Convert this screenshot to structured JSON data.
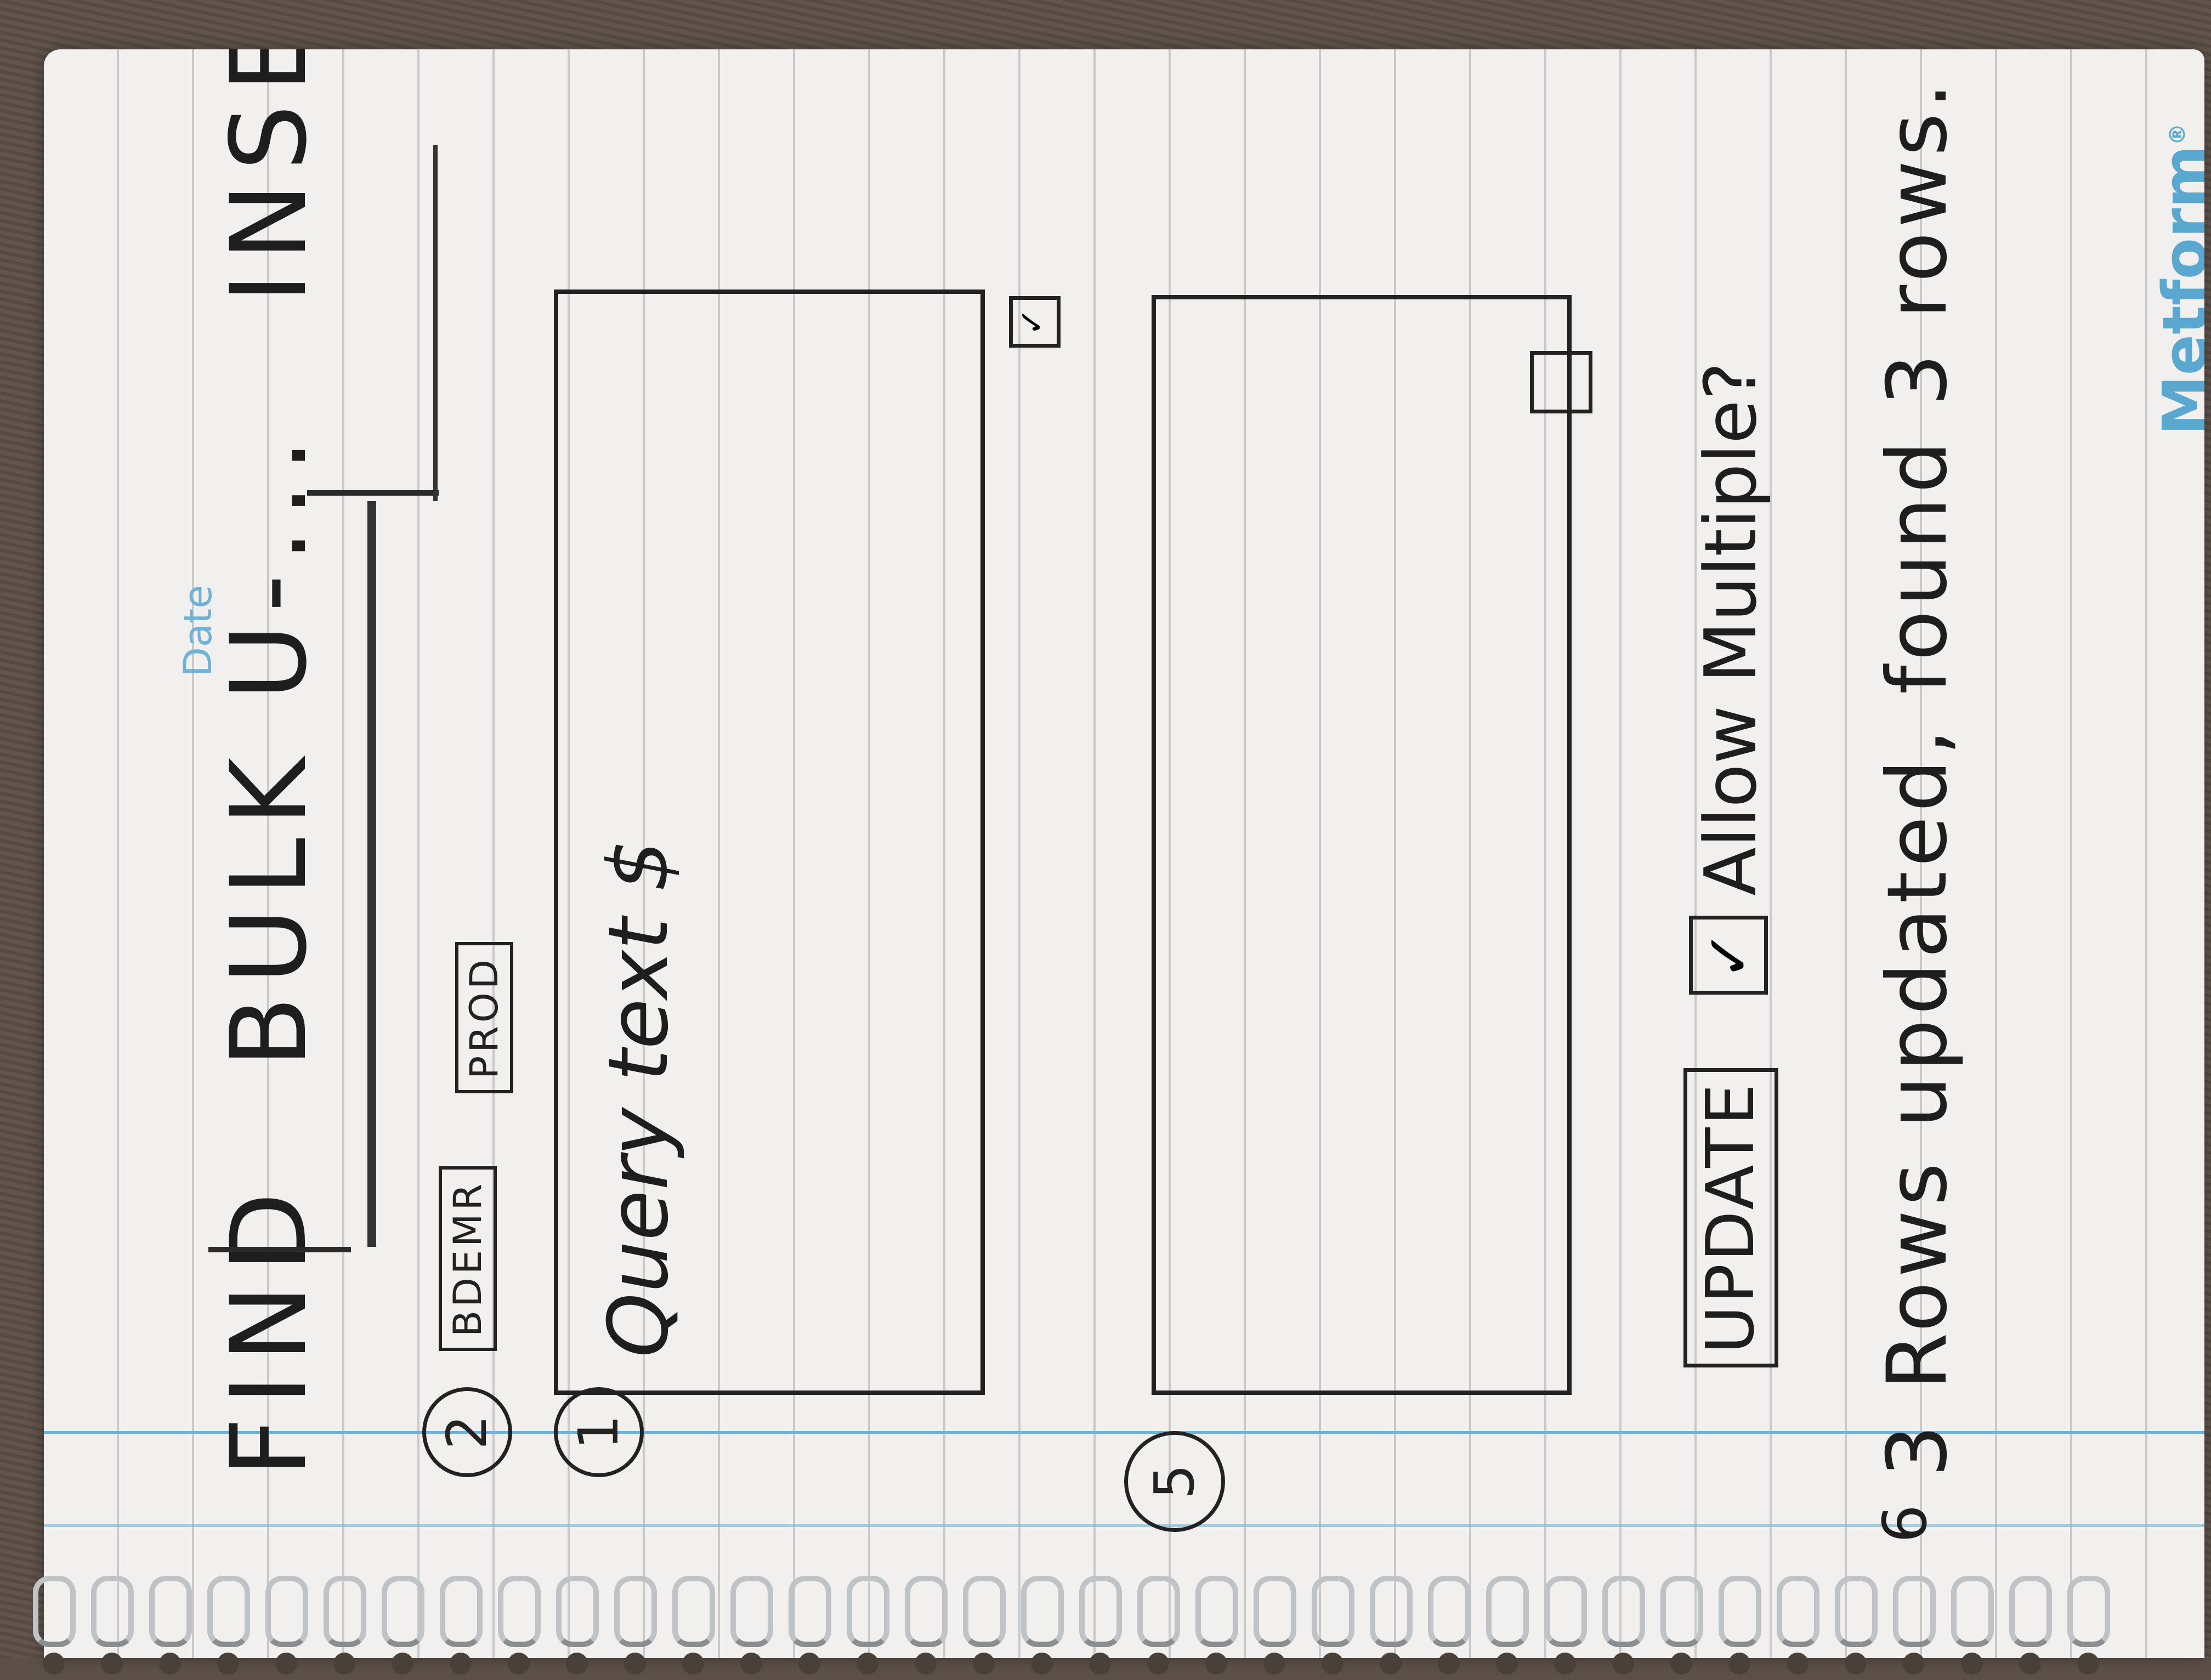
{
  "notebook": {
    "date_label": "Date",
    "brand": "Metform",
    "brand_mark": "®"
  },
  "sketch": {
    "tabs": [
      {
        "label": "FIND"
      },
      {
        "label": "BULK U-..."
      },
      {
        "label": "INSERT"
      }
    ],
    "step_env": "2",
    "env_buttons": [
      {
        "label": "BDEMR"
      },
      {
        "label": "PROD"
      }
    ],
    "step_query": "1",
    "query_placeholder": "Query text $",
    "query_checkbox": "✓",
    "step_results": "5",
    "update_button": "UPDATE",
    "allow_multiple_checkbox": "✓",
    "allow_multiple_label": "Allow Multiple?",
    "step_status": "6",
    "status_text": "3 Rows updated, found 3 rows."
  },
  "colors": {
    "paper": "#f1f0ee",
    "ink": "#1e1e1e",
    "margin_line": "#6fb2d6",
    "desk": "#5d5048"
  }
}
